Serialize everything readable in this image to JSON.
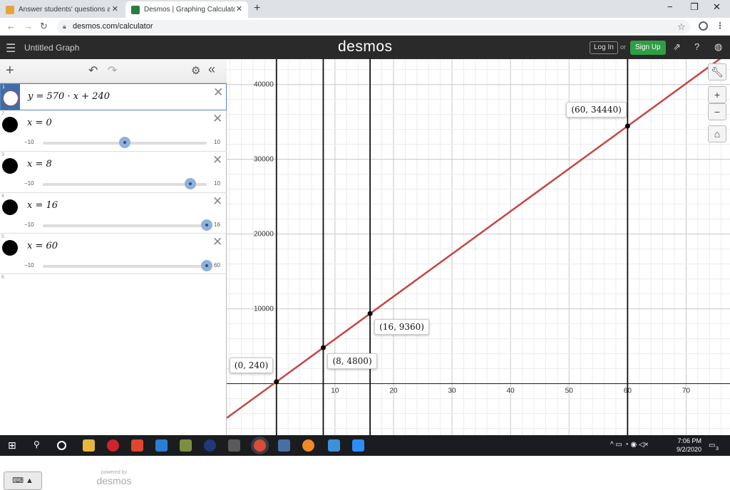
{
  "browser": {
    "tabs": [
      {
        "title": "Answer students' questions and e",
        "active": false
      },
      {
        "title": "Desmos | Graphing Calculator",
        "active": true
      }
    ],
    "url": "desmos.com/calculator"
  },
  "header": {
    "graph_title": "Untitled Graph",
    "brand": "desmos",
    "login_label": "Log In",
    "or_label": "or",
    "signup_label": "Sign Up"
  },
  "expressions": [
    {
      "index": "1",
      "formula": "y = 570 · x + 240"
    },
    {
      "index": "2",
      "formula": "x = 0",
      "slider_min": "−10",
      "slider_max": "10",
      "value": 0
    },
    {
      "index": "3",
      "formula": "x = 8",
      "slider_min": "−10",
      "slider_max": "10",
      "value": 8
    },
    {
      "index": "4",
      "formula": "x = 16",
      "slider_min": "−10",
      "slider_max": "16",
      "value": 16
    },
    {
      "index": "5",
      "formula": "x = 60",
      "slider_min": "−10",
      "slider_max": "60",
      "value": 60
    },
    {
      "index": "6"
    }
  ],
  "powered_by": {
    "line1": "powered by",
    "line2": "desmos"
  },
  "graph": {
    "x_ticks": [
      "10",
      "20",
      "30",
      "40",
      "50",
      "60",
      "70"
    ],
    "y_ticks": [
      "10000",
      "20000",
      "30000",
      "40000"
    ],
    "x_range": [
      -8.5,
      77.5
    ],
    "y_range": [
      -6900,
      43400
    ],
    "line": {
      "slope": 570,
      "intercept": 240,
      "color": "#c74440"
    },
    "vertical_lines": [
      0,
      8,
      16,
      60
    ],
    "points": [
      {
        "x": 0,
        "y": 240,
        "label": "(0, 240)"
      },
      {
        "x": 8,
        "y": 4800,
        "label": "(8, 4800)"
      },
      {
        "x": 16,
        "y": 9360,
        "label": "(16, 9360)"
      },
      {
        "x": 60,
        "y": 34440,
        "label": "(60, 34440)"
      }
    ]
  },
  "taskbar": {
    "time": "7:06 PM",
    "date": "9/2/2020",
    "notifications": "3"
  }
}
